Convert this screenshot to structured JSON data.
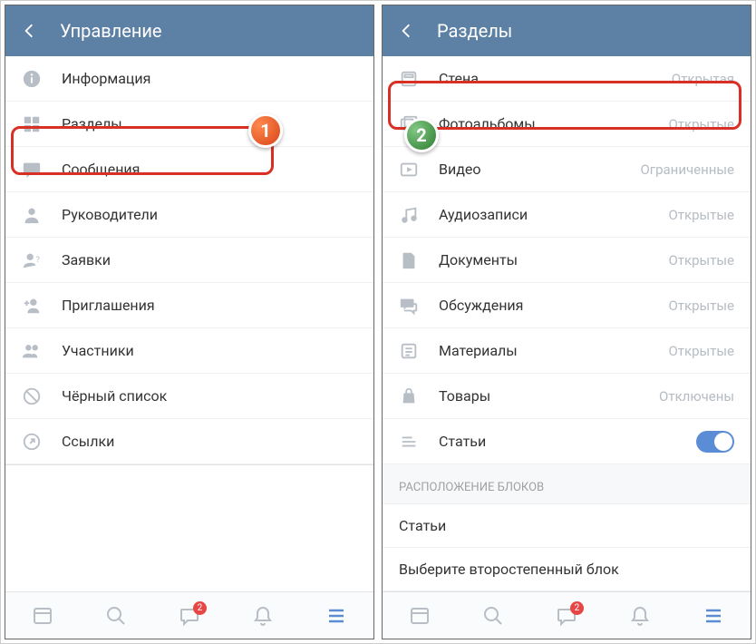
{
  "left": {
    "header_title": "Управление",
    "items": [
      {
        "label": "Информация"
      },
      {
        "label": "Разделы"
      },
      {
        "label": "Сообщения"
      },
      {
        "label": "Руководители"
      },
      {
        "label": "Заявки"
      },
      {
        "label": "Приглашения"
      },
      {
        "label": "Участники"
      },
      {
        "label": "Чёрный список"
      },
      {
        "label": "Ссылки"
      }
    ]
  },
  "right": {
    "header_title": "Разделы",
    "items": [
      {
        "label": "Стена",
        "value": "Открытая"
      },
      {
        "label": "Фотоальбомы",
        "value": "Открытые"
      },
      {
        "label": "Видео",
        "value": "Ограниченные"
      },
      {
        "label": "Аудиозаписи",
        "value": "Открытые"
      },
      {
        "label": "Документы",
        "value": "Открытые"
      },
      {
        "label": "Обсуждения",
        "value": "Открытые"
      },
      {
        "label": "Материалы",
        "value": "Открытые"
      },
      {
        "label": "Товары",
        "value": "Отключены"
      },
      {
        "label": "Статьи",
        "toggle": true
      }
    ],
    "section_header": "РАСПОЛОЖЕНИЕ БЛОКОВ",
    "block_items": [
      "Статьи",
      "Выберите второстепенный блок"
    ]
  },
  "nav": {
    "messages_badge": "2"
  },
  "markers": {
    "step1": "1",
    "step2": "2"
  },
  "colors": {
    "header_bg": "#5d80a5",
    "icon_gray": "#b8bec6",
    "highlight": "#d93025"
  }
}
